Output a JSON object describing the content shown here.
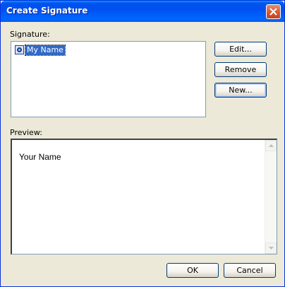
{
  "window": {
    "title": "Create Signature"
  },
  "signature": {
    "label": "Signature:",
    "items": [
      {
        "label": "My Name",
        "icon": "signature-icon",
        "selected": true
      }
    ]
  },
  "buttons": {
    "edit": "Edit...",
    "remove": "Remove",
    "new": "New...",
    "ok": "OK",
    "cancel": "Cancel"
  },
  "preview": {
    "label": "Preview:",
    "text": "Your Name"
  },
  "colors": {
    "titlebar": "#0054e3",
    "selection": "#316ac5",
    "dialog_bg": "#ece9d8"
  }
}
